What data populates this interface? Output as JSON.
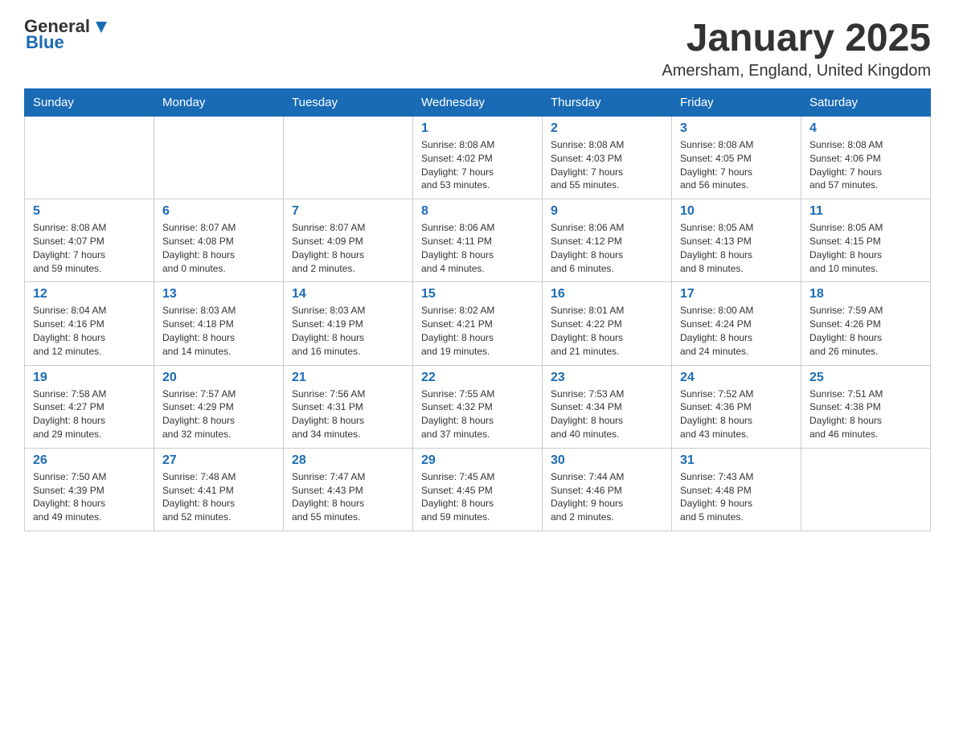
{
  "header": {
    "logo": {
      "text_general": "General",
      "text_blue": "Blue"
    },
    "month_title": "January 2025",
    "location": "Amersham, England, United Kingdom"
  },
  "days_of_week": [
    "Sunday",
    "Monday",
    "Tuesday",
    "Wednesday",
    "Thursday",
    "Friday",
    "Saturday"
  ],
  "weeks": [
    [
      {
        "day": "",
        "info": ""
      },
      {
        "day": "",
        "info": ""
      },
      {
        "day": "",
        "info": ""
      },
      {
        "day": "1",
        "info": "Sunrise: 8:08 AM\nSunset: 4:02 PM\nDaylight: 7 hours\nand 53 minutes."
      },
      {
        "day": "2",
        "info": "Sunrise: 8:08 AM\nSunset: 4:03 PM\nDaylight: 7 hours\nand 55 minutes."
      },
      {
        "day": "3",
        "info": "Sunrise: 8:08 AM\nSunset: 4:05 PM\nDaylight: 7 hours\nand 56 minutes."
      },
      {
        "day": "4",
        "info": "Sunrise: 8:08 AM\nSunset: 4:06 PM\nDaylight: 7 hours\nand 57 minutes."
      }
    ],
    [
      {
        "day": "5",
        "info": "Sunrise: 8:08 AM\nSunset: 4:07 PM\nDaylight: 7 hours\nand 59 minutes."
      },
      {
        "day": "6",
        "info": "Sunrise: 8:07 AM\nSunset: 4:08 PM\nDaylight: 8 hours\nand 0 minutes."
      },
      {
        "day": "7",
        "info": "Sunrise: 8:07 AM\nSunset: 4:09 PM\nDaylight: 8 hours\nand 2 minutes."
      },
      {
        "day": "8",
        "info": "Sunrise: 8:06 AM\nSunset: 4:11 PM\nDaylight: 8 hours\nand 4 minutes."
      },
      {
        "day": "9",
        "info": "Sunrise: 8:06 AM\nSunset: 4:12 PM\nDaylight: 8 hours\nand 6 minutes."
      },
      {
        "day": "10",
        "info": "Sunrise: 8:05 AM\nSunset: 4:13 PM\nDaylight: 8 hours\nand 8 minutes."
      },
      {
        "day": "11",
        "info": "Sunrise: 8:05 AM\nSunset: 4:15 PM\nDaylight: 8 hours\nand 10 minutes."
      }
    ],
    [
      {
        "day": "12",
        "info": "Sunrise: 8:04 AM\nSunset: 4:16 PM\nDaylight: 8 hours\nand 12 minutes."
      },
      {
        "day": "13",
        "info": "Sunrise: 8:03 AM\nSunset: 4:18 PM\nDaylight: 8 hours\nand 14 minutes."
      },
      {
        "day": "14",
        "info": "Sunrise: 8:03 AM\nSunset: 4:19 PM\nDaylight: 8 hours\nand 16 minutes."
      },
      {
        "day": "15",
        "info": "Sunrise: 8:02 AM\nSunset: 4:21 PM\nDaylight: 8 hours\nand 19 minutes."
      },
      {
        "day": "16",
        "info": "Sunrise: 8:01 AM\nSunset: 4:22 PM\nDaylight: 8 hours\nand 21 minutes."
      },
      {
        "day": "17",
        "info": "Sunrise: 8:00 AM\nSunset: 4:24 PM\nDaylight: 8 hours\nand 24 minutes."
      },
      {
        "day": "18",
        "info": "Sunrise: 7:59 AM\nSunset: 4:26 PM\nDaylight: 8 hours\nand 26 minutes."
      }
    ],
    [
      {
        "day": "19",
        "info": "Sunrise: 7:58 AM\nSunset: 4:27 PM\nDaylight: 8 hours\nand 29 minutes."
      },
      {
        "day": "20",
        "info": "Sunrise: 7:57 AM\nSunset: 4:29 PM\nDaylight: 8 hours\nand 32 minutes."
      },
      {
        "day": "21",
        "info": "Sunrise: 7:56 AM\nSunset: 4:31 PM\nDaylight: 8 hours\nand 34 minutes."
      },
      {
        "day": "22",
        "info": "Sunrise: 7:55 AM\nSunset: 4:32 PM\nDaylight: 8 hours\nand 37 minutes."
      },
      {
        "day": "23",
        "info": "Sunrise: 7:53 AM\nSunset: 4:34 PM\nDaylight: 8 hours\nand 40 minutes."
      },
      {
        "day": "24",
        "info": "Sunrise: 7:52 AM\nSunset: 4:36 PM\nDaylight: 8 hours\nand 43 minutes."
      },
      {
        "day": "25",
        "info": "Sunrise: 7:51 AM\nSunset: 4:38 PM\nDaylight: 8 hours\nand 46 minutes."
      }
    ],
    [
      {
        "day": "26",
        "info": "Sunrise: 7:50 AM\nSunset: 4:39 PM\nDaylight: 8 hours\nand 49 minutes."
      },
      {
        "day": "27",
        "info": "Sunrise: 7:48 AM\nSunset: 4:41 PM\nDaylight: 8 hours\nand 52 minutes."
      },
      {
        "day": "28",
        "info": "Sunrise: 7:47 AM\nSunset: 4:43 PM\nDaylight: 8 hours\nand 55 minutes."
      },
      {
        "day": "29",
        "info": "Sunrise: 7:45 AM\nSunset: 4:45 PM\nDaylight: 8 hours\nand 59 minutes."
      },
      {
        "day": "30",
        "info": "Sunrise: 7:44 AM\nSunset: 4:46 PM\nDaylight: 9 hours\nand 2 minutes."
      },
      {
        "day": "31",
        "info": "Sunrise: 7:43 AM\nSunset: 4:48 PM\nDaylight: 9 hours\nand 5 minutes."
      },
      {
        "day": "",
        "info": ""
      }
    ]
  ]
}
